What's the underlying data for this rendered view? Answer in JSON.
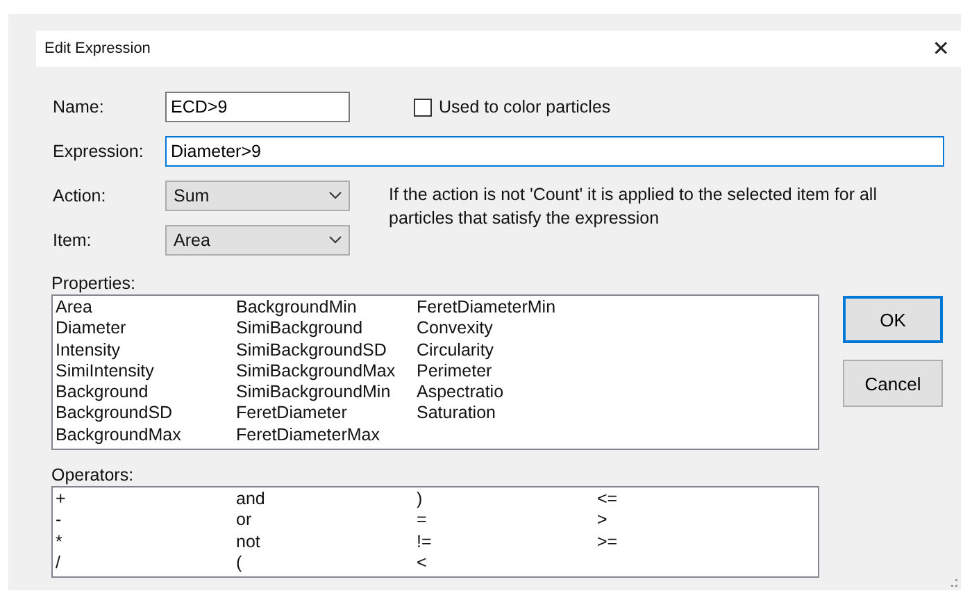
{
  "window": {
    "title": "Edit Expression",
    "close": "✕"
  },
  "name": {
    "label": "Name:",
    "value": "ECD>9"
  },
  "color_checkbox": {
    "label": "Used to color particles",
    "checked": false
  },
  "expression": {
    "label": "Expression:",
    "value": "Diameter>9",
    "focused": true
  },
  "action": {
    "label": "Action:",
    "value": "Sum"
  },
  "item": {
    "label": "Item:",
    "value": "Area"
  },
  "help_text": "If the action is not 'Count' it is applied to the selected item for all particles that satisfy the expression",
  "properties": {
    "label": "Properties:",
    "items": [
      "Area",
      "Diameter",
      "Intensity",
      "SimiIntensity",
      "Background",
      "BackgroundSD",
      "BackgroundMax",
      "BackgroundMin",
      "SimiBackground",
      "SimiBackgroundSD",
      "SimiBackgroundMax",
      "SimiBackgroundMin",
      "FeretDiameter",
      "FeretDiameterMax",
      "FeretDiameterMin",
      "Convexity",
      "Circularity",
      "Perimeter",
      "Aspectratio",
      "Saturation"
    ]
  },
  "operators": {
    "label": "Operators:",
    "items": [
      "+",
      "-",
      "*",
      "/",
      "and",
      "or",
      "not",
      "(",
      ")",
      "=",
      "!=",
      "<",
      "<=",
      ">",
      ">="
    ]
  },
  "buttons": [
    {
      "label": "OK",
      "default": true
    },
    {
      "label": "Cancel",
      "default": false
    }
  ]
}
